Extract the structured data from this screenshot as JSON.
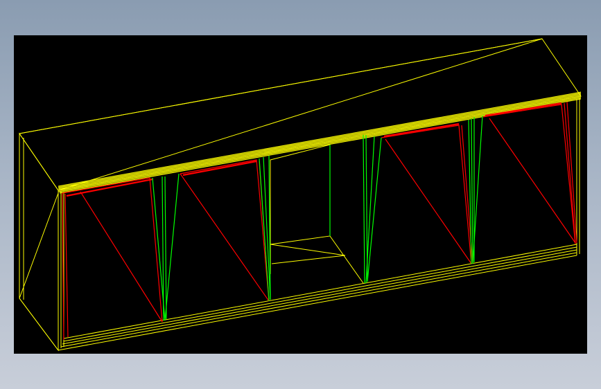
{
  "viewport": {
    "background": "#000000",
    "render_mode": "wireframe",
    "line_colors": {
      "cabinet_frame": "#ffff00",
      "cabinet_doors": "#ff0000",
      "dividers": "#00ff00"
    }
  },
  "model": {
    "description_visible": false
  },
  "page_background": [
    "#8a9cb1",
    "#c8ced9"
  ]
}
